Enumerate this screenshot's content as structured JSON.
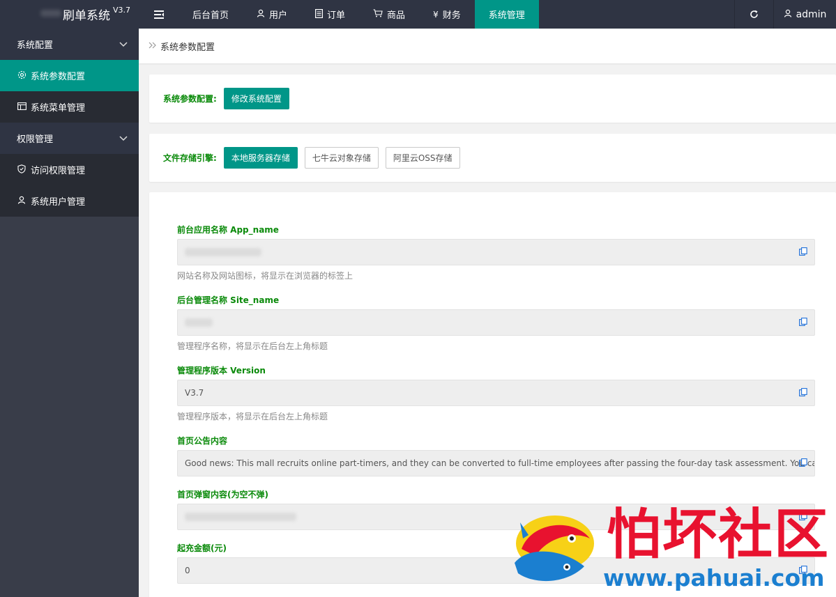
{
  "header": {
    "app_name": "刷单系统",
    "version": "V3.7",
    "menu_icon": "menu-collapse-icon",
    "nav": [
      {
        "label": "后台首页",
        "icon": ""
      },
      {
        "label": "用户",
        "icon": "user-icon"
      },
      {
        "label": "订单",
        "icon": "document-icon"
      },
      {
        "label": "商品",
        "icon": "cart-icon"
      },
      {
        "label": "财务",
        "icon": "yen-icon"
      },
      {
        "label": "系统管理",
        "icon": ""
      }
    ],
    "active_nav": "系统管理",
    "user": "admin"
  },
  "sidebar": {
    "groups": [
      {
        "label": "系统配置",
        "items": [
          {
            "label": "系统参数配置",
            "icon": "gear-icon"
          },
          {
            "label": "系统菜单管理",
            "icon": "table-icon"
          }
        ]
      },
      {
        "label": "权限管理",
        "items": [
          {
            "label": "访问权限管理",
            "icon": "shield-icon"
          },
          {
            "label": "系统用户管理",
            "icon": "user-icon"
          }
        ]
      }
    ],
    "active_item": "系统参数配置"
  },
  "breadcrumb": "系统参数配置",
  "config_card": {
    "label": "系统参数配置:",
    "button": "修改系统配置"
  },
  "storage_card": {
    "label": "文件存储引擎:",
    "options": [
      "本地服务器存储",
      "七牛云对象存储",
      "阿里云OSS存储"
    ],
    "selected": "本地服务器存储"
  },
  "fields": [
    {
      "label": "前台应用名称 App_name",
      "value": "",
      "help": "网站名称及网站图标，将显示在浏览器的标签上"
    },
    {
      "label": "后台管理名称 Site_name",
      "value": "",
      "help": "管理程序名称，将显示在后台左上角标题"
    },
    {
      "label": "管理程序版本 Version",
      "value": "V3.7",
      "help": "管理程序版本，将显示在后台左上角标题"
    },
    {
      "label": "首页公告内容",
      "value": "Good news: This mall recruits online part-timers, and they can be converted to full-time employees after passing the four-day task assessment. You can receiv",
      "help": ""
    },
    {
      "label": "首页弹窗内容(为空不弹)",
      "value": "",
      "help": ""
    },
    {
      "label": "起充金额(元)",
      "value": "0",
      "help": ""
    }
  ],
  "watermark": {
    "text": "怕坏社区",
    "url": "www.pahuai.com"
  },
  "colors": {
    "accent": "#009688",
    "topbar": "#2f3443",
    "sidebar": "#393d49",
    "label_green": "#0a8a0a",
    "watermark_red": "#e8122f",
    "watermark_blue": "#1b7fd0"
  }
}
